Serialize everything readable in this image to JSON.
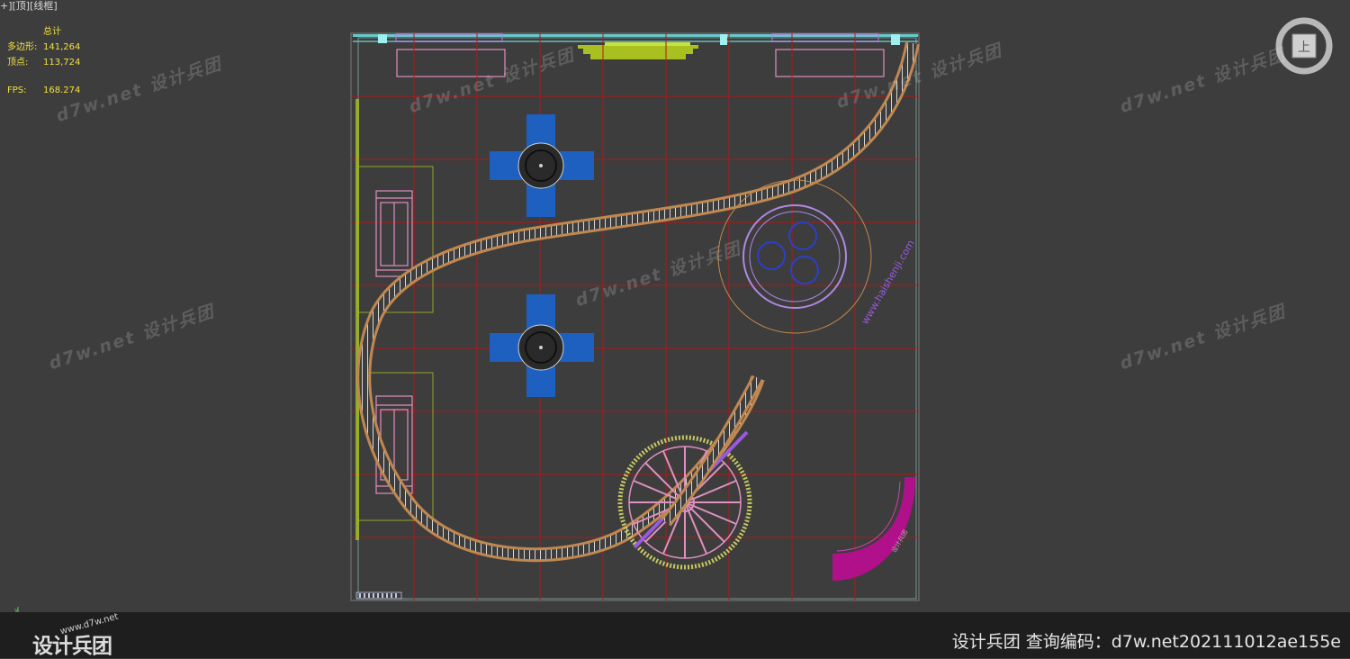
{
  "viewport": {
    "label": "+][顶][线框]"
  },
  "stats": {
    "header": "总计",
    "polygons_label": "多边形:",
    "polygons_value": "141,264",
    "vertices_label": "顶点:",
    "vertices_value": "113,724",
    "fps_label": "FPS:",
    "fps_value": "168.274"
  },
  "scene": {
    "circle_logo_text": "www.haishenji.com",
    "arc_sign_text": "设计兵团"
  },
  "viewcube": {
    "face_label": "上"
  },
  "watermarks": {
    "text": "d7w.net 设计兵团"
  },
  "status_bar": {
    "query_code": "设计兵团  查询编码：d7w.net202111012ae155e",
    "logo_text": "设计兵团",
    "logo_url": "www.d7w.net"
  },
  "colors": {
    "background": "#3d3d3d",
    "grid_red": "#b01818",
    "track_orange": "#c08850",
    "blue_seat": "#1e60c0",
    "magenta": "#b0108a",
    "pink": "#e090c0",
    "yellow_green": "#a8c020",
    "stats_yellow": "#f0e040"
  },
  "icons": [
    "viewcube-icon",
    "axis-tripod-icon"
  ]
}
